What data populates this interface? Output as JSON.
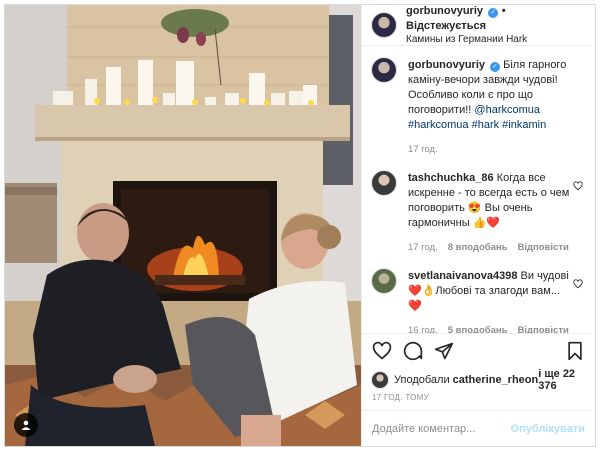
{
  "header": {
    "username": "gorbunovyuriy",
    "follow_label": "Відстежується",
    "location": "Камины из Германии Hark"
  },
  "caption": {
    "username": "gorbunovyuriy",
    "text": "Біля гарного каміну-вечори завжди чудові! Особливо коли є про що поговорити!!",
    "mention": "@harkcomua",
    "hashtags": "#harkcomua #hark #inkamin",
    "time": "17 год."
  },
  "comments": [
    {
      "username": "tashchuchka_86",
      "text": "Когда все искренне - то всегда есть о чем поговорить 😍 Вы очень гармоничны 👍❤️",
      "time": "17 год.",
      "likes": "8 вподобань",
      "reply": "Відповісти"
    },
    {
      "username": "svetlanaivanova4398",
      "text": "Ви чудові ❤️👌Любові та злагоди вам...❤️",
      "time": "16 год.",
      "likes": "5 вподобань",
      "reply": "Відповісти"
    }
  ],
  "likes": {
    "prefix": "Уподобали ",
    "user": "catherine_rheon",
    "suffix": " і ще 22 376"
  },
  "timeago": "17 ГОД. ТОМУ",
  "add_comment": {
    "placeholder": "Додайте коментар...",
    "publish_label": "Опублікувати"
  },
  "icons": {
    "like": "heart-icon",
    "comment": "comment-icon",
    "share": "send-icon",
    "save": "bookmark-icon",
    "tag": "user-tag-icon"
  },
  "colors": {
    "verified": "#3897f0",
    "publish_disabled": "#b2dffc",
    "secondary_text": "#8e8e8e",
    "link": "#00376b"
  }
}
